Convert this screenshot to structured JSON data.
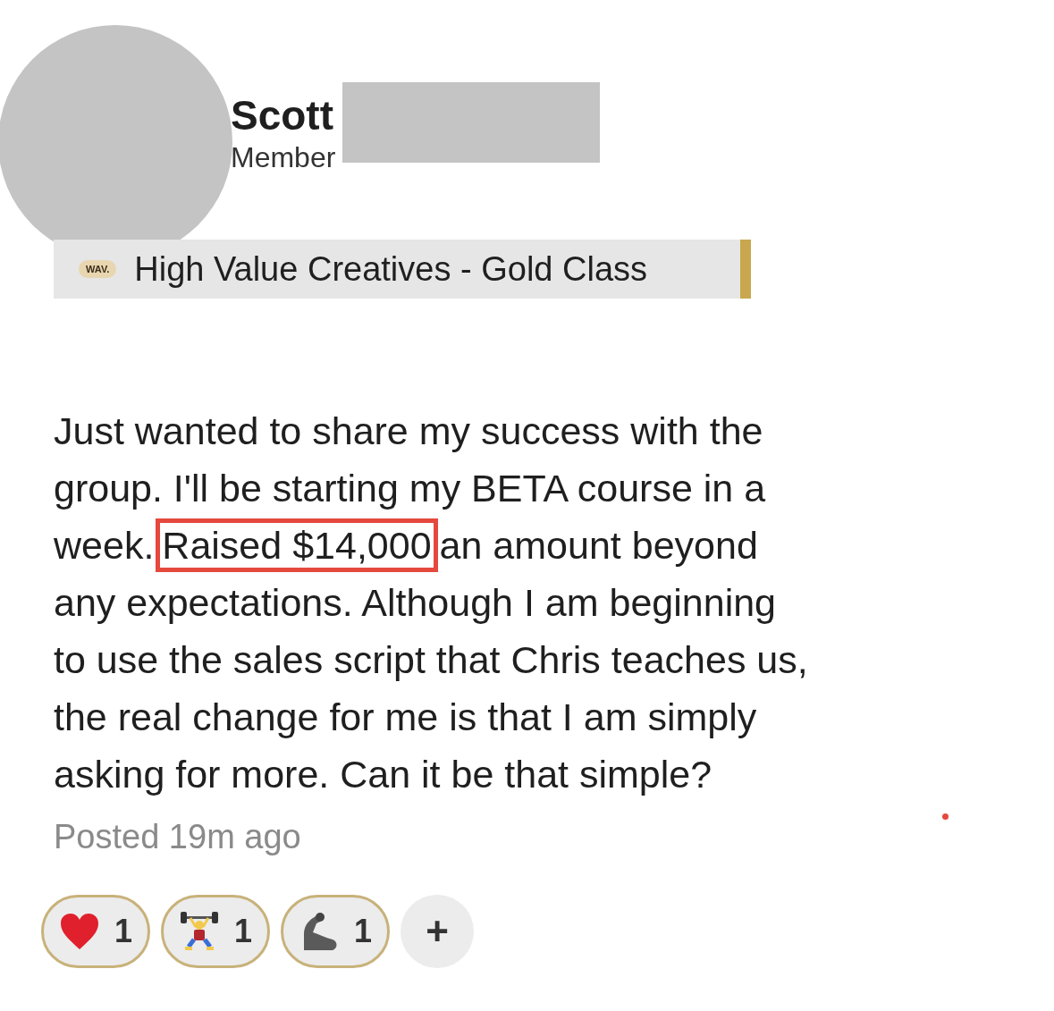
{
  "author": {
    "name": "Scott",
    "role": "Member"
  },
  "badge": {
    "logo_text": "WAV.",
    "label": "High Value Creatives - Gold Class"
  },
  "post": {
    "lines": [
      [
        {
          "text": "Just wanted to share my success with the",
          "highlighted": false
        }
      ],
      [
        {
          "text": "group. I'll be starting my BETA course in a",
          "highlighted": false
        }
      ],
      [
        {
          "text": "week.",
          "highlighted": false
        },
        {
          "text": "Raised $14,000",
          "highlighted": true
        },
        {
          "text": "an amount beyond",
          "highlighted": false
        }
      ],
      [
        {
          "text": "any expectations. Although I am beginning",
          "highlighted": false
        }
      ],
      [
        {
          "text": "to use the sales script that Chris teaches us,",
          "highlighted": false
        }
      ],
      [
        {
          "text": "the real change for me is that I am simply",
          "highlighted": false
        }
      ],
      [
        {
          "text": "asking for more. Can it be that simple?",
          "highlighted": false
        }
      ]
    ],
    "timestamp": "Posted 19m ago"
  },
  "reactions": [
    {
      "kind": "heart",
      "count": "1"
    },
    {
      "kind": "weightlifter",
      "count": "1"
    },
    {
      "kind": "flexed-arm",
      "count": "1"
    }
  ],
  "add_reaction": "+"
}
